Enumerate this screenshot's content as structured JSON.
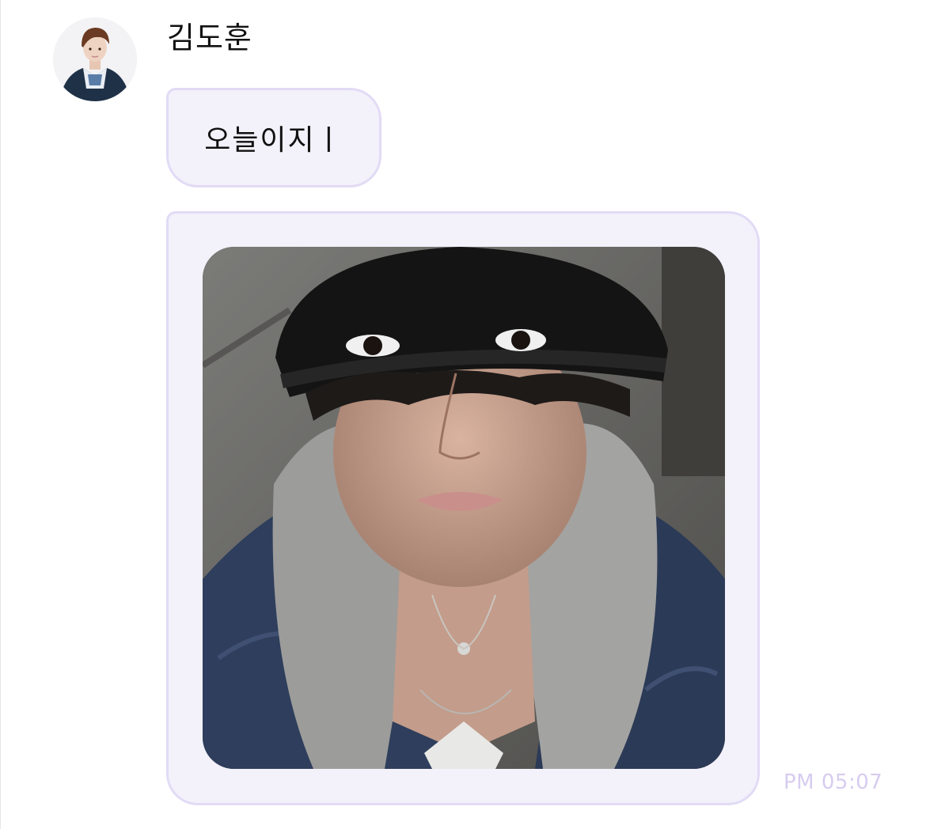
{
  "chat": {
    "sender": {
      "name": "김도훈",
      "avatar_icon": "profile-avatar"
    },
    "messages": [
      {
        "type": "text",
        "text": "오늘이지ㅣ"
      },
      {
        "type": "image",
        "description_icon": "selfie-photo"
      }
    ],
    "timestamp": "PM 05:07"
  },
  "colors": {
    "bubble_fill": "#f3f1fa",
    "bubble_border": "#e2dbf5",
    "timestamp": "#d7ccef",
    "text": "#111111"
  }
}
